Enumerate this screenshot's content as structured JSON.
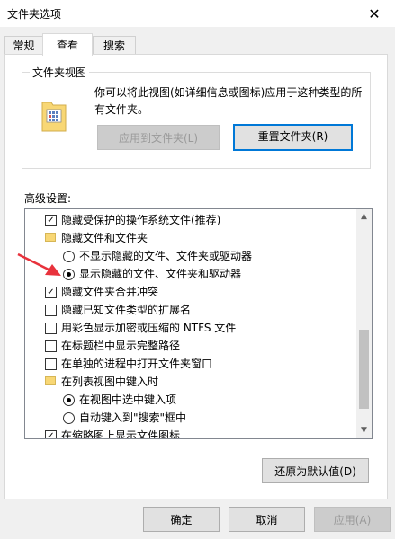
{
  "window": {
    "title": "文件夹选项",
    "close_glyph": "✕"
  },
  "tabs": [
    {
      "label": "常规",
      "active": false
    },
    {
      "label": "查看",
      "active": true
    },
    {
      "label": "搜索",
      "active": false
    }
  ],
  "folder_view": {
    "title": "文件夹视图",
    "description": "你可以将此视图(如详细信息或图标)应用于这种类型的所有文件夹。",
    "apply_button": "应用到文件夹(L)",
    "reset_button": "重置文件夹(R)"
  },
  "advanced": {
    "label": "高级设置:",
    "items": [
      {
        "type": "checkbox",
        "checked": true,
        "indent": 0,
        "label": "隐藏受保护的操作系统文件(推荐)"
      },
      {
        "type": "folder",
        "indent": 0,
        "label": "隐藏文件和文件夹"
      },
      {
        "type": "radio",
        "checked": false,
        "indent": 1,
        "label": "不显示隐藏的文件、文件夹或驱动器"
      },
      {
        "type": "radio",
        "checked": true,
        "indent": 1,
        "label": "显示隐藏的文件、文件夹和驱动器"
      },
      {
        "type": "checkbox",
        "checked": true,
        "indent": 0,
        "label": "隐藏文件夹合并冲突"
      },
      {
        "type": "checkbox",
        "checked": false,
        "indent": 0,
        "label": "隐藏已知文件类型的扩展名"
      },
      {
        "type": "checkbox",
        "checked": false,
        "indent": 0,
        "label": "用彩色显示加密或压缩的 NTFS 文件"
      },
      {
        "type": "checkbox",
        "checked": false,
        "indent": 0,
        "label": "在标题栏中显示完整路径"
      },
      {
        "type": "checkbox",
        "checked": false,
        "indent": 0,
        "label": "在单独的进程中打开文件夹窗口"
      },
      {
        "type": "folder",
        "indent": 0,
        "label": "在列表视图中键入时"
      },
      {
        "type": "radio",
        "checked": true,
        "indent": 1,
        "label": "在视图中选中键入项"
      },
      {
        "type": "radio",
        "checked": false,
        "indent": 1,
        "label": "自动键入到\"搜索\"框中"
      },
      {
        "type": "checkbox",
        "checked": true,
        "indent": 0,
        "label": "在缩略图上显示文件图标"
      }
    ],
    "restore_button": "还原为默认值(D)"
  },
  "footer": {
    "ok": "确定",
    "cancel": "取消",
    "apply": "应用(A)"
  },
  "colors": {
    "annotation_arrow": "#e8323c",
    "focus_border": "#0078d7",
    "folder": "#f8d775"
  }
}
